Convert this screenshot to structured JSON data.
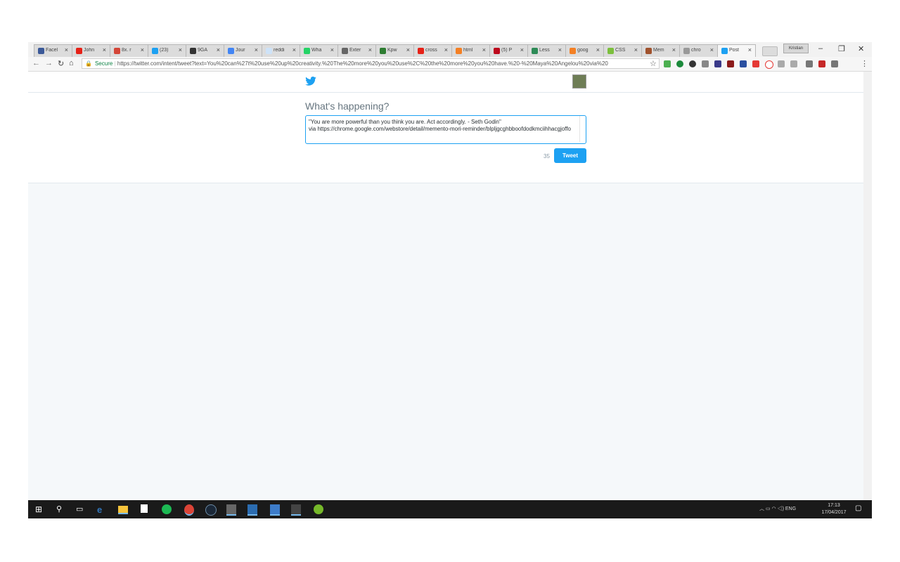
{
  "browser": {
    "tabs": [
      {
        "label": "Facel",
        "icon": "facebook-icon",
        "color": "#3b5998"
      },
      {
        "label": "John",
        "icon": "youtube-icon",
        "color": "#e62117"
      },
      {
        "label": "8x. r",
        "icon": "gmail-icon",
        "color": "#d44638"
      },
      {
        "label": "(23)",
        "icon": "twitter-icon",
        "color": "#1da1f2"
      },
      {
        "label": "9GA",
        "icon": "9gag-icon",
        "color": "#333333"
      },
      {
        "label": "Jour",
        "icon": "journal-icon",
        "color": "#4285f4"
      },
      {
        "label": "reddi",
        "icon": "reddit-icon",
        "color": "#cee3f8"
      },
      {
        "label": "Wha",
        "icon": "whatsapp-icon",
        "color": "#25d366"
      },
      {
        "label": "Exter",
        "icon": "extensions-icon",
        "color": "#666666"
      },
      {
        "label": "Kpw",
        "icon": "bb-icon",
        "color": "#2e7d32"
      },
      {
        "label": "cross",
        "icon": "youtube-icon",
        "color": "#e62117"
      },
      {
        "label": "html",
        "icon": "stackoverflow-icon",
        "color": "#f48024"
      },
      {
        "label": "(5) P",
        "icon": "pinterest-icon",
        "color": "#bd081c"
      },
      {
        "label": "Less",
        "icon": "lesson-icon",
        "color": "#2e8b57"
      },
      {
        "label": "goog",
        "icon": "stackoverflow-icon",
        "color": "#f48024"
      },
      {
        "label": "CSS",
        "icon": "css-icon",
        "color": "#7cbf3d"
      },
      {
        "label": "Mem",
        "icon": "memento-icon",
        "color": "#a0522d"
      },
      {
        "label": "chro",
        "icon": "chrome-store-icon",
        "color": "#999999"
      },
      {
        "label": "Post",
        "icon": "twitter-icon",
        "color": "#1da1f2"
      }
    ],
    "profile_label": "Kristian",
    "secure_label": "Secure",
    "url": "https://twitter.com/intent/tweet?text=You%20can%27t%20use%20up%20creativity.%20The%20more%20you%20use%2C%20the%20more%20you%20have.%20-%20Maya%20Angelou%20via%20"
  },
  "twitter": {
    "heading": "What's happening?",
    "tweet_text": "\"You are more powerful than you think you are. Act accordingly. - Seth Godin\"\nvia https://chrome.google.com/webstore/detail/memento-mori-reminder/blpljgcghbboofdodkmciihhacgjoffo",
    "char_count": "35",
    "tweet_button": "Tweet",
    "colors": {
      "accent": "#1da1f2"
    }
  },
  "taskbar": {
    "tray_language": "ENG",
    "time": "17:13",
    "date": "17/04/2017"
  }
}
